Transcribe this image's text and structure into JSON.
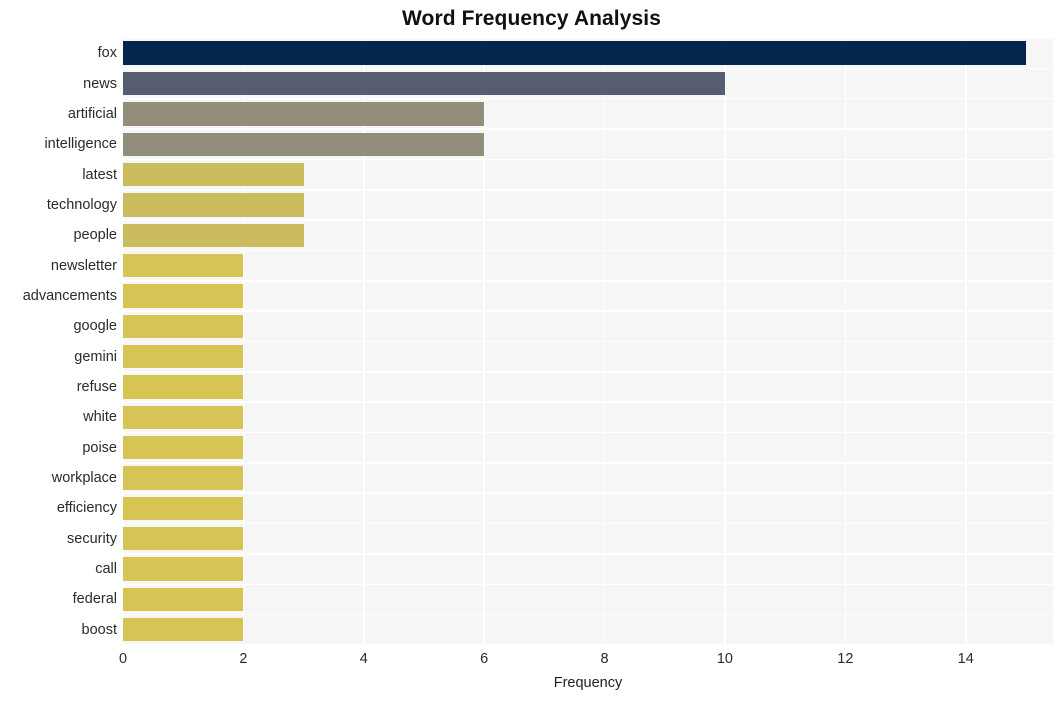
{
  "chart_data": {
    "type": "bar",
    "orientation": "horizontal",
    "title": "Word Frequency Analysis",
    "xlabel": "Frequency",
    "ylabel": "",
    "xlim": [
      0,
      15.45
    ],
    "xticks": [
      0,
      2,
      4,
      6,
      8,
      10,
      12,
      14
    ],
    "xticklabels": [
      "0",
      "2",
      "4",
      "6",
      "8",
      "10",
      "12",
      "14"
    ],
    "grid": true,
    "legend": null,
    "categories": [
      "fox",
      "news",
      "artificial",
      "intelligence",
      "latest",
      "technology",
      "people",
      "newsletter",
      "advancements",
      "google",
      "gemini",
      "refuse",
      "white",
      "poise",
      "workplace",
      "efficiency",
      "security",
      "call",
      "federal",
      "boost"
    ],
    "values": [
      15,
      10,
      6,
      6,
      3,
      3,
      3,
      2,
      2,
      2,
      2,
      2,
      2,
      2,
      2,
      2,
      2,
      2,
      2,
      2
    ],
    "bar_colors": [
      "#04264c",
      "#575d70",
      "#938d7b",
      "#938d7b",
      "#c9bb5e",
      "#c9bb5e",
      "#c9bb5e",
      "#d6c455",
      "#d6c455",
      "#d6c455",
      "#d6c455",
      "#d6c455",
      "#d6c455",
      "#d6c455",
      "#d6c455",
      "#d6c455",
      "#d6c455",
      "#d6c455",
      "#d6c455",
      "#d6c455"
    ],
    "plot_background": "#f6f6f7",
    "gridline_color": "#ffffff",
    "text_color": "#2b2b2b"
  }
}
